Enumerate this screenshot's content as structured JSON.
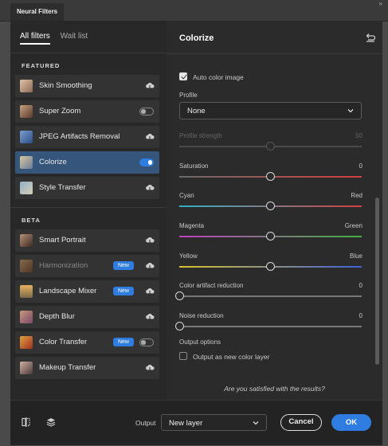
{
  "window": {
    "title": "Neural Filters"
  },
  "sidebar": {
    "tabs": [
      {
        "label": "All filters",
        "active": true
      },
      {
        "label": "Wait list",
        "active": false
      }
    ],
    "sections": [
      {
        "title": "FEATURED",
        "items": [
          {
            "label": "Skin Smoothing",
            "control": "cloud-download-icon"
          },
          {
            "label": "Super Zoom",
            "control": "toggle-off"
          },
          {
            "label": "JPEG Artifacts Removal",
            "control": "cloud-download-icon"
          },
          {
            "label": "Colorize",
            "control": "toggle-on",
            "selected": true
          },
          {
            "label": "Style Transfer",
            "control": "cloud-download-icon"
          }
        ]
      },
      {
        "title": "BETA",
        "items": [
          {
            "label": "Smart Portrait",
            "control": "cloud-download-icon"
          },
          {
            "label": "Harmonization",
            "control": "cloud-download-icon",
            "badge": "New",
            "dimmed": true
          },
          {
            "label": "Landscape Mixer",
            "control": "cloud-download-icon",
            "badge": "New"
          },
          {
            "label": "Depth Blur",
            "control": "cloud-download-icon"
          },
          {
            "label": "Color Transfer",
            "control": "toggle-off",
            "badge": "New"
          },
          {
            "label": "Makeup Transfer",
            "control": "cloud-download-icon"
          }
        ]
      }
    ]
  },
  "panel": {
    "title": "Colorize",
    "auto_color": {
      "label": "Auto color image",
      "checked": true
    },
    "profile": {
      "label": "Profile",
      "value": "None"
    },
    "profile_strength": {
      "label": "Profile strength",
      "value": "50",
      "level": 0.5,
      "disabled": true
    },
    "saturation": {
      "label": "Saturation",
      "value": "0",
      "level": 0.5
    },
    "cyan_red": {
      "left": "Cyan",
      "right": "Red",
      "level": 0.5
    },
    "magenta_green": {
      "left": "Magenta",
      "right": "Green",
      "level": 0.5
    },
    "yellow_blue": {
      "left": "Yellow",
      "right": "Blue",
      "level": 0.5
    },
    "artifact_reduction": {
      "label": "Color artifact reduction",
      "value": "0",
      "level": 0
    },
    "noise_reduction": {
      "label": "Noise reduction",
      "value": "0",
      "level": 0
    },
    "output_options": {
      "label": "Output options",
      "checkbox_label": "Output as new color layer",
      "checked": false
    },
    "question": "Are you satisfied with the results?"
  },
  "footer": {
    "output_label": "Output",
    "output_value": "New layer",
    "cancel": "Cancel",
    "ok": "OK"
  },
  "colors": {
    "accent": "#2f7de1",
    "selected_item": "#35557a"
  }
}
